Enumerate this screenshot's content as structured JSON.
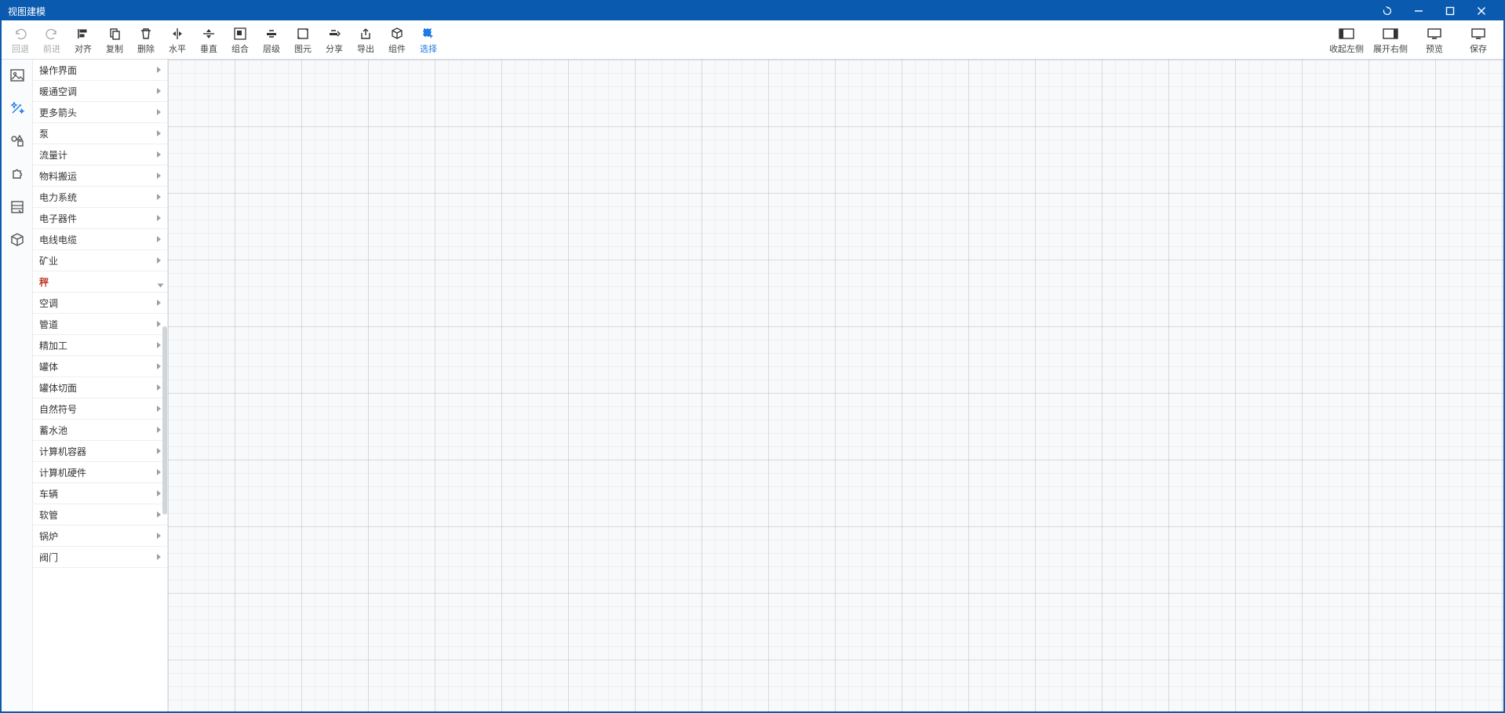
{
  "window": {
    "title": "视图建模"
  },
  "toolbar": {
    "left": [
      {
        "id": "undo",
        "label": "回退",
        "disabled": true
      },
      {
        "id": "redo",
        "label": "前进",
        "disabled": true
      },
      {
        "id": "align",
        "label": "对齐"
      },
      {
        "id": "copy",
        "label": "复制"
      },
      {
        "id": "delete",
        "label": "删除"
      },
      {
        "id": "hflip",
        "label": "水平"
      },
      {
        "id": "vflip",
        "label": "垂直"
      },
      {
        "id": "group",
        "label": "组合"
      },
      {
        "id": "layer",
        "label": "层级"
      },
      {
        "id": "primitive",
        "label": "图元"
      },
      {
        "id": "share",
        "label": "分享"
      },
      {
        "id": "export",
        "label": "导出"
      },
      {
        "id": "component",
        "label": "组件"
      },
      {
        "id": "select",
        "label": "选择",
        "active": true
      }
    ],
    "right": [
      {
        "id": "fold-left",
        "label": "收起左侧"
      },
      {
        "id": "open-right",
        "label": "展开右侧"
      },
      {
        "id": "preview",
        "label": "预览"
      },
      {
        "id": "save",
        "label": "保存"
      }
    ]
  },
  "rail": [
    {
      "id": "gallery",
      "icon": "image-wand"
    },
    {
      "id": "magic",
      "icon": "magic",
      "active": true
    },
    {
      "id": "shapes",
      "icon": "shapes"
    },
    {
      "id": "plugins",
      "icon": "puzzle"
    },
    {
      "id": "datasheet",
      "icon": "sheet"
    },
    {
      "id": "model3d",
      "icon": "cube"
    }
  ],
  "categories": [
    {
      "label": "操作界面"
    },
    {
      "label": "暖通空调"
    },
    {
      "label": "更多箭头"
    },
    {
      "label": "泵"
    },
    {
      "label": "流量计"
    },
    {
      "label": "物料搬运"
    },
    {
      "label": "电力系统"
    },
    {
      "label": "电子器件"
    },
    {
      "label": "电线电缆"
    },
    {
      "label": "矿业"
    },
    {
      "label": "秤",
      "selected": true
    },
    {
      "label": "空调"
    },
    {
      "label": "管道"
    },
    {
      "label": "精加工"
    },
    {
      "label": "罐体"
    },
    {
      "label": "罐体切面"
    },
    {
      "label": "自然符号"
    },
    {
      "label": "蓄水池"
    },
    {
      "label": "计算机容器"
    },
    {
      "label": "计算机硬件"
    },
    {
      "label": "车辆"
    },
    {
      "label": "软管"
    },
    {
      "label": "锅炉"
    },
    {
      "label": "阀门"
    }
  ]
}
